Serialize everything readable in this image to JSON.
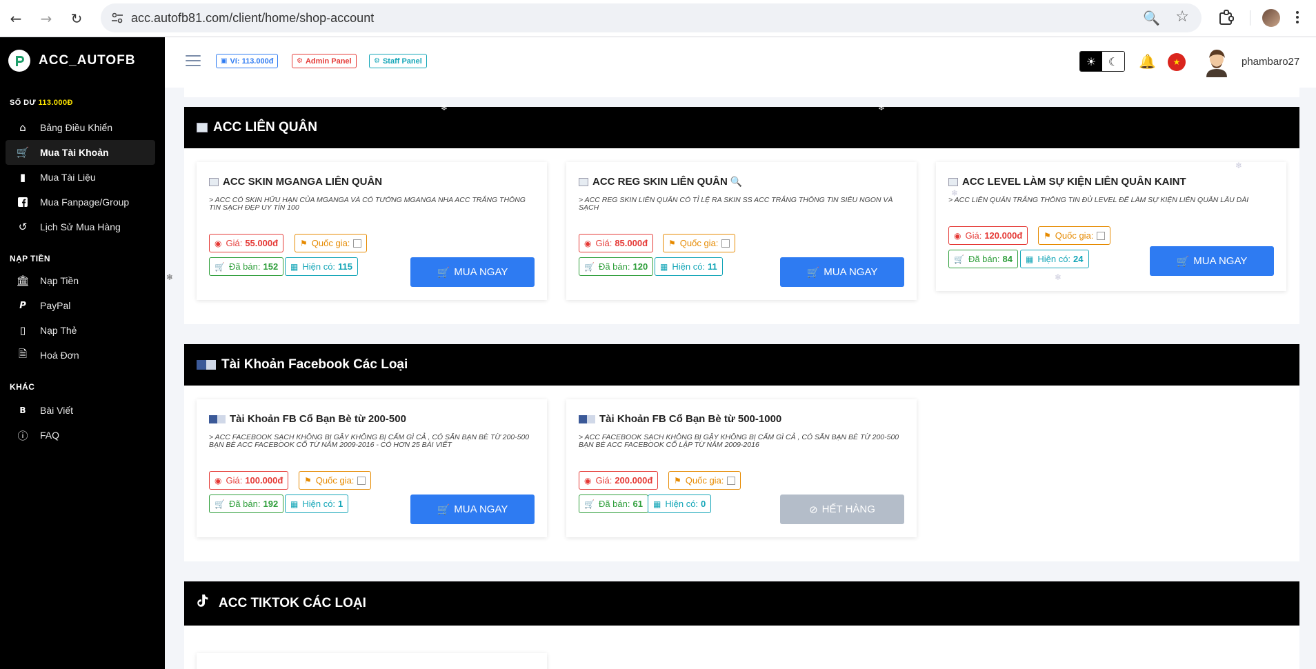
{
  "browser": {
    "url": "acc.autofb81.com/client/home/shop-account"
  },
  "sidebar": {
    "logo_text": "ACC_AUTOFB",
    "balance_label": "SỐ DƯ",
    "balance_amount": "113.000Đ",
    "items_main": [
      {
        "label": "Bảng Điều Khiển",
        "icon": "home-icon"
      },
      {
        "label": "Mua Tài Khoản",
        "icon": "cart-icon"
      },
      {
        "label": "Mua Tài Liệu",
        "icon": "book-icon"
      },
      {
        "label": "Mua Fanpage/Group",
        "icon": "facebook-icon"
      },
      {
        "label": "Lịch Sử Mua Hàng",
        "icon": "history-icon"
      }
    ],
    "section_topup": "NẠP TIỀN",
    "items_topup": [
      {
        "label": "Nạp Tiền",
        "icon": "bank-icon"
      },
      {
        "label": "PayPal",
        "icon": "paypal-icon"
      },
      {
        "label": "Nạp Thẻ",
        "icon": "card-icon"
      },
      {
        "label": "Hoá Đơn",
        "icon": "invoice-icon"
      }
    ],
    "section_other": "KHÁC",
    "items_other": [
      {
        "label": "Bài Viết",
        "icon": "blog-icon"
      },
      {
        "label": "FAQ",
        "icon": "question-icon"
      }
    ]
  },
  "topbar": {
    "wallet": "Ví: 113.000đ",
    "admin": "Admin Panel",
    "staff": "Staff Panel",
    "username": "phambaro27"
  },
  "sections": [
    {
      "title": "ACC LIÊN QUÂN",
      "cards": [
        {
          "title": "ACC SKIN MGANGA LIÊN QUÂN",
          "desc": "ACC CÓ SKIN HỮU HẠN CỦA MGANGA VÀ CÓ TƯỚNG MGANGA NHA ACC TRẮNG THÔNG TIN SẠCH ĐẸP UY TÍN 100",
          "price": "55.000đ",
          "sold": "152",
          "stock": "115",
          "button": "MUA NGAY"
        },
        {
          "title": "ACC REG SKIN LIÊN QUÂN",
          "desc": "ACC REG SKIN LIÊN QUÂN CÓ TỈ LỆ RA SKIN SS ACC TRẮNG THÔNG TIN SIÊU NGON VÀ SẠCH",
          "price": "85.000đ",
          "sold": "120",
          "stock": "11",
          "button": "MUA NGAY"
        },
        {
          "title": "ACC LEVEL LÀM SỰ KIỆN LIÊN QUÂN KAINT",
          "desc": "ACC LIÊN QUÂN TRẮNG THÔNG TIN ĐỦ LEVEL ĐỂ LÀM SỰ KIỆN LIÊN QUÂN LÂU DÀI",
          "price": "120.000đ",
          "sold": "84",
          "stock": "24",
          "button": "MUA NGAY"
        }
      ]
    },
    {
      "title": "Tài Khoản Facebook Các Loại",
      "cards": [
        {
          "title": "Tài Khoản FB Cổ Bạn Bè từ 200-500",
          "desc": "ACC FACEBOOK SẠCH KHÔNG BỊ GẬY KHÔNG BỊ CẤM GÌ CẢ , CÓ SẴN BẠN BÈ TỪ 200-500 BẠN BÈ ACC FACEBOOK CỔ TỪ NĂM 2009-2016 - CÓ HƠN 25 BÀI VIẾT",
          "price": "100.000đ",
          "sold": "192",
          "stock": "1",
          "button": "MUA NGAY"
        },
        {
          "title": "Tài Khoản FB Cổ Bạn Bè từ 500-1000",
          "desc": "ACC FACEBOOK SẠCH KHÔNG BỊ GẬY KHÔNG BỊ CẤM GÌ CẢ , CÓ SẴN BẠN BÈ TỪ 200-500 BẠN BÈ ACC FACEBOOK CỔ LẬP TỪ NĂM 2009-2016",
          "price": "200.000đ",
          "sold": "61",
          "stock": "0",
          "button": "HẾT HÀNG"
        }
      ]
    },
    {
      "title": "ACC TIKTOK CÁC LOẠI"
    }
  ],
  "labels": {
    "price": "Giá:",
    "country": "Quốc gia:",
    "sold": "Đã bán:",
    "stock": "Hiện có:"
  },
  "colors": {
    "sidebar_bg": "#000000",
    "balance_amount": "#ffe600",
    "buy_button": "#2e7bf2",
    "disabled_button": "#b4bdc9",
    "price_red": "#e53935",
    "country_orange": "#e68a00",
    "sold_green": "#2e9e3a",
    "stock_teal": "#12a5b7"
  }
}
